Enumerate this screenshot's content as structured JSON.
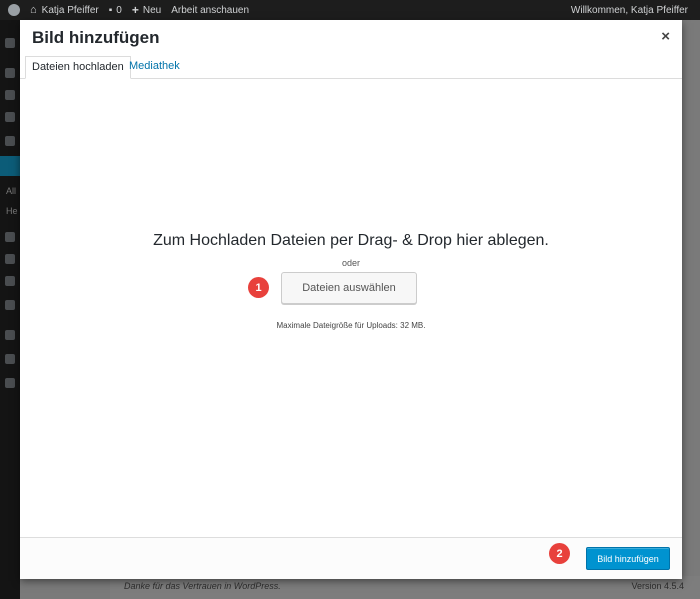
{
  "adminbar": {
    "site_name": "Katja Pfeiffer",
    "comments_count": "0",
    "new_label": "Neu",
    "customize_label": "Arbeit anschauen",
    "greeting": "Willkommen, Katja Pfeiffer"
  },
  "sidebar": {
    "label_a": "All",
    "label_h": "He"
  },
  "modal": {
    "title": "Bild hinzufügen",
    "close_glyph": "×",
    "tabs": [
      {
        "label": "Dateien hochladen",
        "active": true
      },
      {
        "label": "Mediathek",
        "active": false
      }
    ],
    "drop_instructions": "Zum Hochladen Dateien per Drag- & Drop hier ablegen.",
    "or_text": "oder",
    "select_files_label": "Dateien auswählen",
    "max_upload_text": "Maximale Dateigröße für Uploads: 32 MB.",
    "insert_button_label": "Bild hinzufügen"
  },
  "markers": {
    "one": "1",
    "two": "2"
  },
  "footer": {
    "thanks_text": "Danke für das Vertrauen in WordPress.",
    "version_text": "Version 4.5.4"
  },
  "colors": {
    "accent": "#0073aa",
    "primary_button": "#0093d0",
    "marker": "#e8413c",
    "adminbar": "#1d1d1d"
  },
  "icons": [
    "wordpress-logo-icon",
    "home-icon",
    "comment-bubble-icon",
    "plus-icon",
    "close-icon"
  ]
}
